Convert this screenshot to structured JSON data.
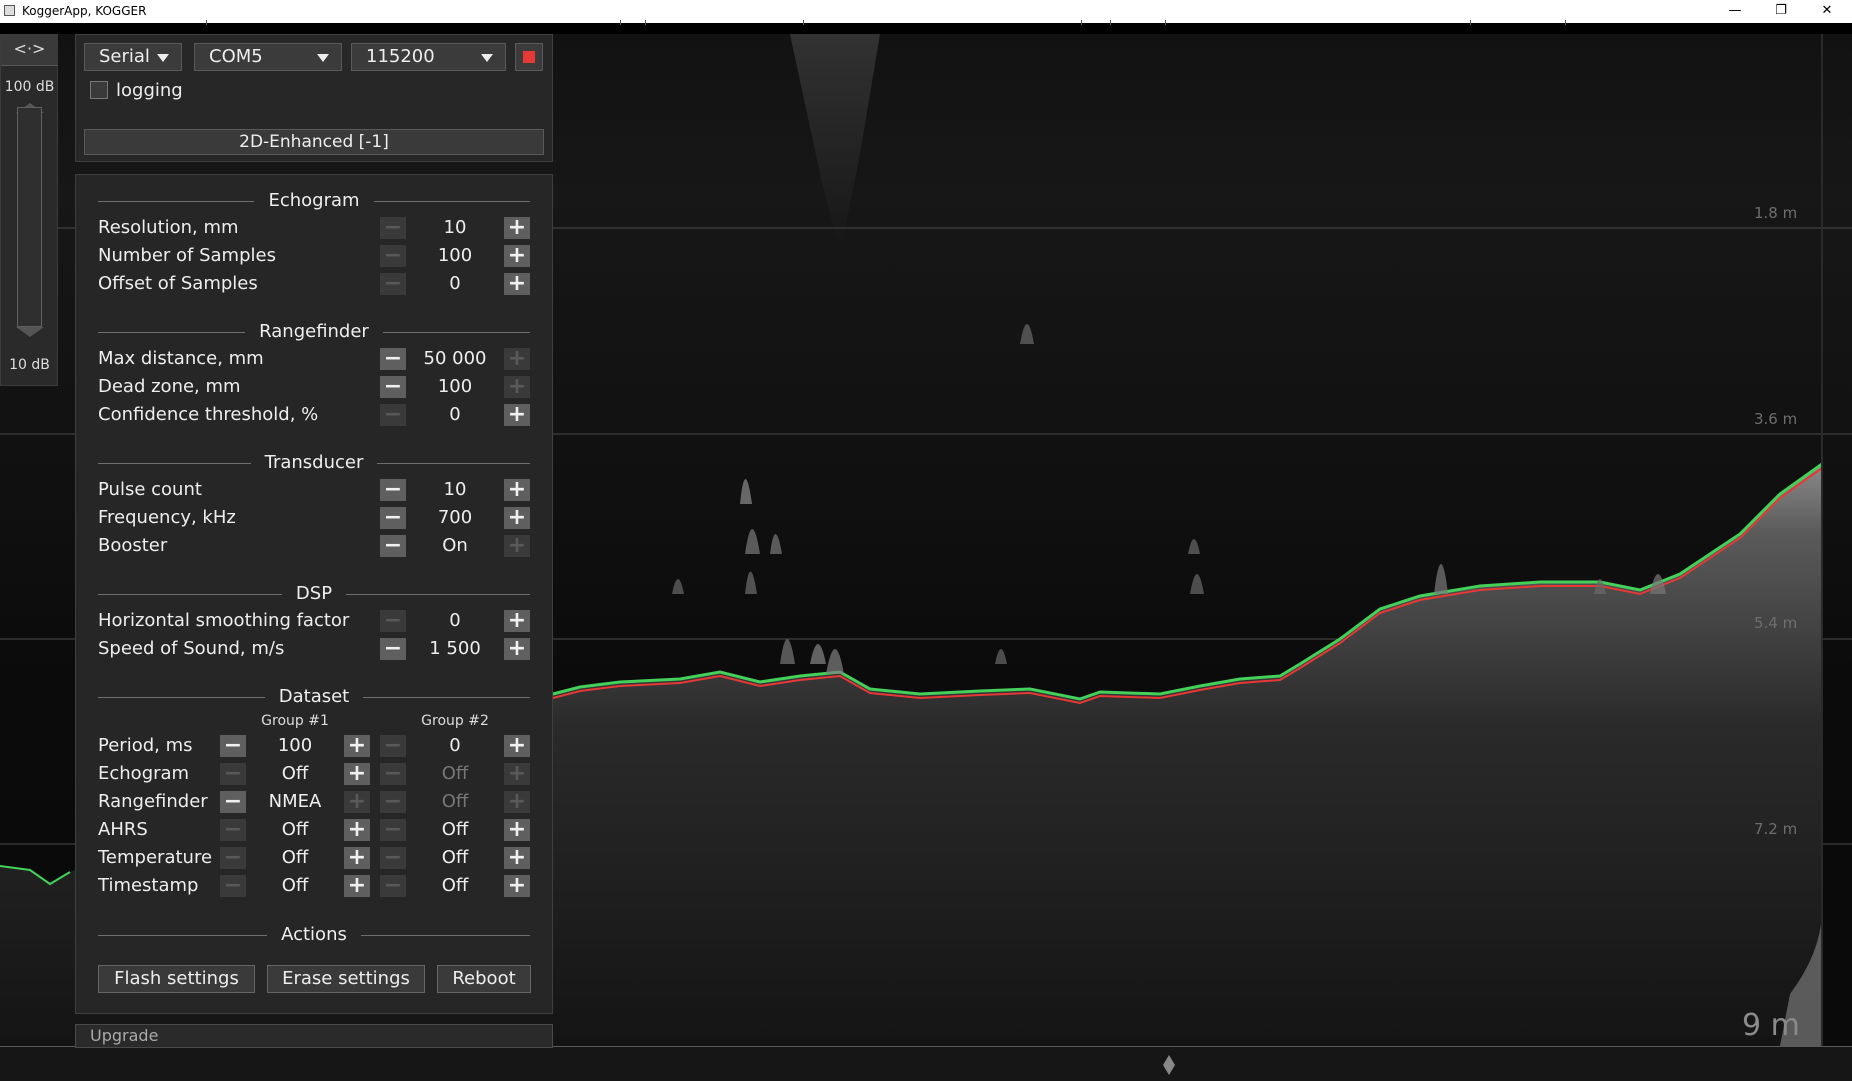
{
  "window": {
    "title": "KoggerApp, KOGGER"
  },
  "connection": {
    "type": "Serial",
    "port": "COM5",
    "baudrate": "115200",
    "logging_label": "logging",
    "mode": "2D-Enhanced [-1]"
  },
  "gain": {
    "toggle_symbol": "<·>",
    "max_label": "100 dB",
    "min_label": "10 dB"
  },
  "sections": {
    "echogram": "Echogram",
    "rangefinder": "Rangefinder",
    "transducer": "Transducer",
    "dsp": "DSP",
    "dataset": "Dataset",
    "actions": "Actions"
  },
  "echogram": {
    "resolution": {
      "label": "Resolution, mm",
      "value": "10"
    },
    "samples": {
      "label": "Number of Samples",
      "value": "100"
    },
    "offset": {
      "label": "Offset of Samples",
      "value": "0"
    }
  },
  "rangefinder": {
    "max_distance": {
      "label": "Max distance, mm",
      "value": "50 000"
    },
    "dead_zone": {
      "label": "Dead zone, mm",
      "value": "100"
    },
    "confidence": {
      "label": "Confidence threshold, %",
      "value": "0"
    }
  },
  "transducer": {
    "pulse": {
      "label": "Pulse count",
      "value": "10"
    },
    "frequency": {
      "label": "Frequency, kHz",
      "value": "700"
    },
    "booster": {
      "label": "Booster",
      "value": "On"
    }
  },
  "dsp": {
    "smoothing": {
      "label": "Horizontal smoothing factor",
      "value": "0"
    },
    "sound_speed": {
      "label": "Speed of Sound, m/s",
      "value": "1 500"
    }
  },
  "dataset": {
    "group1_header": "Group #1",
    "group2_header": "Group #2",
    "rows": [
      {
        "label": "Period, ms",
        "g1": "100",
        "g2": "0"
      },
      {
        "label": "Echogram",
        "g1": "Off",
        "g2": "Off"
      },
      {
        "label": "Rangefinder",
        "g1": "NMEA",
        "g2": "Off"
      },
      {
        "label": "AHRS",
        "g1": "Off",
        "g2": "Off"
      },
      {
        "label": "Temperature",
        "g1": "Off",
        "g2": "Off"
      },
      {
        "label": "Timestamp",
        "g1": "Off",
        "g2": "Off"
      }
    ]
  },
  "actions": {
    "flash": "Flash settings",
    "erase": "Erase settings",
    "reboot": "Reboot"
  },
  "upgrade_label": "Upgrade",
  "depth_labels": {
    "d1": "1.8 m",
    "d2": "3.6 m",
    "d3": "5.4 m",
    "d4": "7.2 m",
    "max": "9 m"
  },
  "colors": {
    "bottom_trace": "#e53935",
    "bottom_trace_alt": "#43d15a",
    "stop": "#e53935"
  }
}
